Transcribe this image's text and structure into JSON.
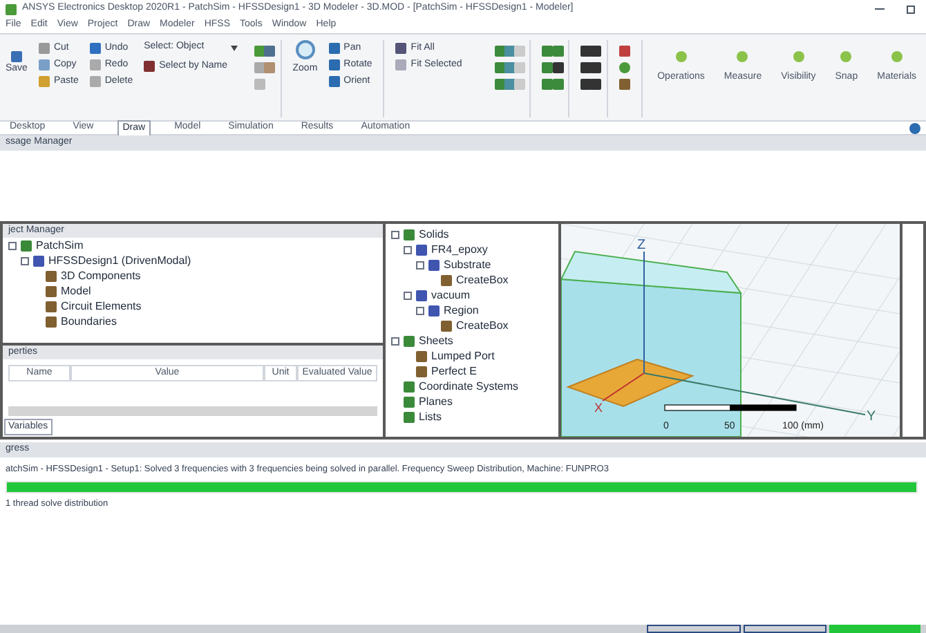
{
  "window": {
    "title": "ANSYS Electronics Desktop 2020R1 - PatchSim - HFSSDesign1 - 3D Modeler - 3D.MOD - [PatchSim - HFSSDesign1 - Modeler]"
  },
  "menu": [
    "File",
    "Edit",
    "View",
    "Project",
    "Draw",
    "Modeler",
    "HFSS",
    "Tools",
    "Window",
    "Help"
  ],
  "ribbon": {
    "save": "Save",
    "clipboard": [
      "Cut",
      "Copy",
      "Paste"
    ],
    "edit": [
      "Undo",
      "Redo",
      "Delete"
    ],
    "select_dropdown": "Select: Object",
    "select_by_name": "Select by Name",
    "zoom": "Zoom",
    "view": [
      "Pan",
      "Rotate",
      "Orient"
    ],
    "fit": [
      "Fit All",
      "Fit Selected"
    ],
    "groups": [
      "Operations",
      "Measure",
      "Visibility",
      "Snap",
      "Materials"
    ]
  },
  "tabs": [
    {
      "label": "Desktop",
      "selected": false
    },
    {
      "label": "View",
      "selected": false
    },
    {
      "label": "Draw",
      "selected": true
    },
    {
      "label": "Model",
      "selected": false
    },
    {
      "label": "Simulation",
      "selected": false
    },
    {
      "label": "Results",
      "selected": false
    },
    {
      "label": "Automation",
      "selected": false
    }
  ],
  "message_manager": {
    "title": "ssage Manager"
  },
  "project_manager": {
    "title": "ject Manager",
    "tree": [
      {
        "label": "PatchSim",
        "children": [
          {
            "label": "HFSSDesign1 (DrivenModal)",
            "children": [
              {
                "label": "3D Components"
              },
              {
                "label": "Model"
              },
              {
                "label": "Circuit Elements"
              },
              {
                "label": "Boundaries"
              }
            ]
          }
        ]
      }
    ]
  },
  "properties": {
    "title": "perties",
    "columns": [
      "Name",
      "Value",
      "Unit",
      "Evaluated Value"
    ],
    "tab": "Variables"
  },
  "model_tree": [
    {
      "label": "Solids",
      "children": [
        {
          "label": "FR4_epoxy",
          "children": [
            {
              "label": "Substrate",
              "children": [
                {
                  "label": "CreateBox"
                }
              ]
            }
          ]
        },
        {
          "label": "vacuum",
          "children": [
            {
              "label": "Region",
              "children": [
                {
                  "label": "CreateBox"
                }
              ]
            }
          ]
        }
      ]
    },
    {
      "label": "Sheets",
      "children": [
        {
          "label": "Lumped Port"
        },
        {
          "label": "Perfect E"
        }
      ]
    },
    {
      "label": "Coordinate Systems"
    },
    {
      "label": "Planes"
    },
    {
      "label": "Lists"
    }
  ],
  "viewport": {
    "axes": [
      "Z",
      "Y",
      "X"
    ],
    "scale": [
      "0",
      "50",
      "100 (mm)"
    ]
  },
  "progress": {
    "title": "gress",
    "message": "atchSim - HFSSDesign1 - Setup1: Solved 3 frequencies with 3 frequencies being solved in parallel. Frequency Sweep Distribution, Machine: FUNPRO3",
    "level": 1.0,
    "status": "1 thread solve distribution"
  }
}
